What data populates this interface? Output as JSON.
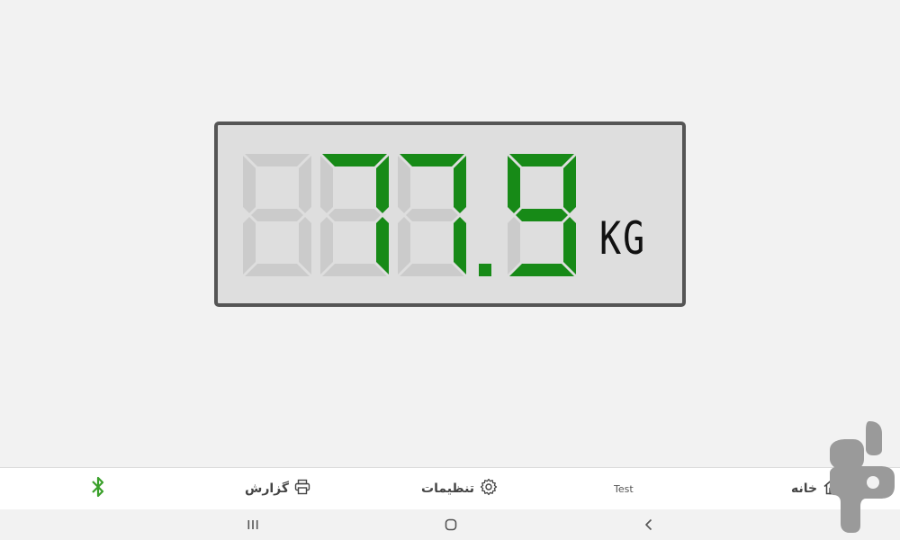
{
  "display": {
    "digits": [
      "8",
      "7",
      "7",
      "9"
    ],
    "active": [
      false,
      true,
      true,
      true
    ],
    "decimal_point_after": 3,
    "unit": "KG",
    "active_color": "#178a17",
    "inactive_color": "#cbcbcb",
    "panel_color": "#dedede",
    "border_color": "#555555"
  },
  "bottom_nav": {
    "bluetooth": {
      "icon": "bluetooth-icon",
      "color": "#3aa02a"
    },
    "report": {
      "label": "گزارش",
      "icon": "printer-icon"
    },
    "settings": {
      "label": "تنظیمات",
      "icon": "gear-icon"
    },
    "test": {
      "label": "Test"
    },
    "home": {
      "label": "خانه",
      "icon": "home-icon"
    }
  },
  "system_nav": {
    "recents": "recents-icon",
    "home": "home-circle-icon",
    "back": "back-chevron-icon"
  },
  "watermark": {
    "icon": "watermark-logo",
    "color": "#9a9a9a"
  }
}
